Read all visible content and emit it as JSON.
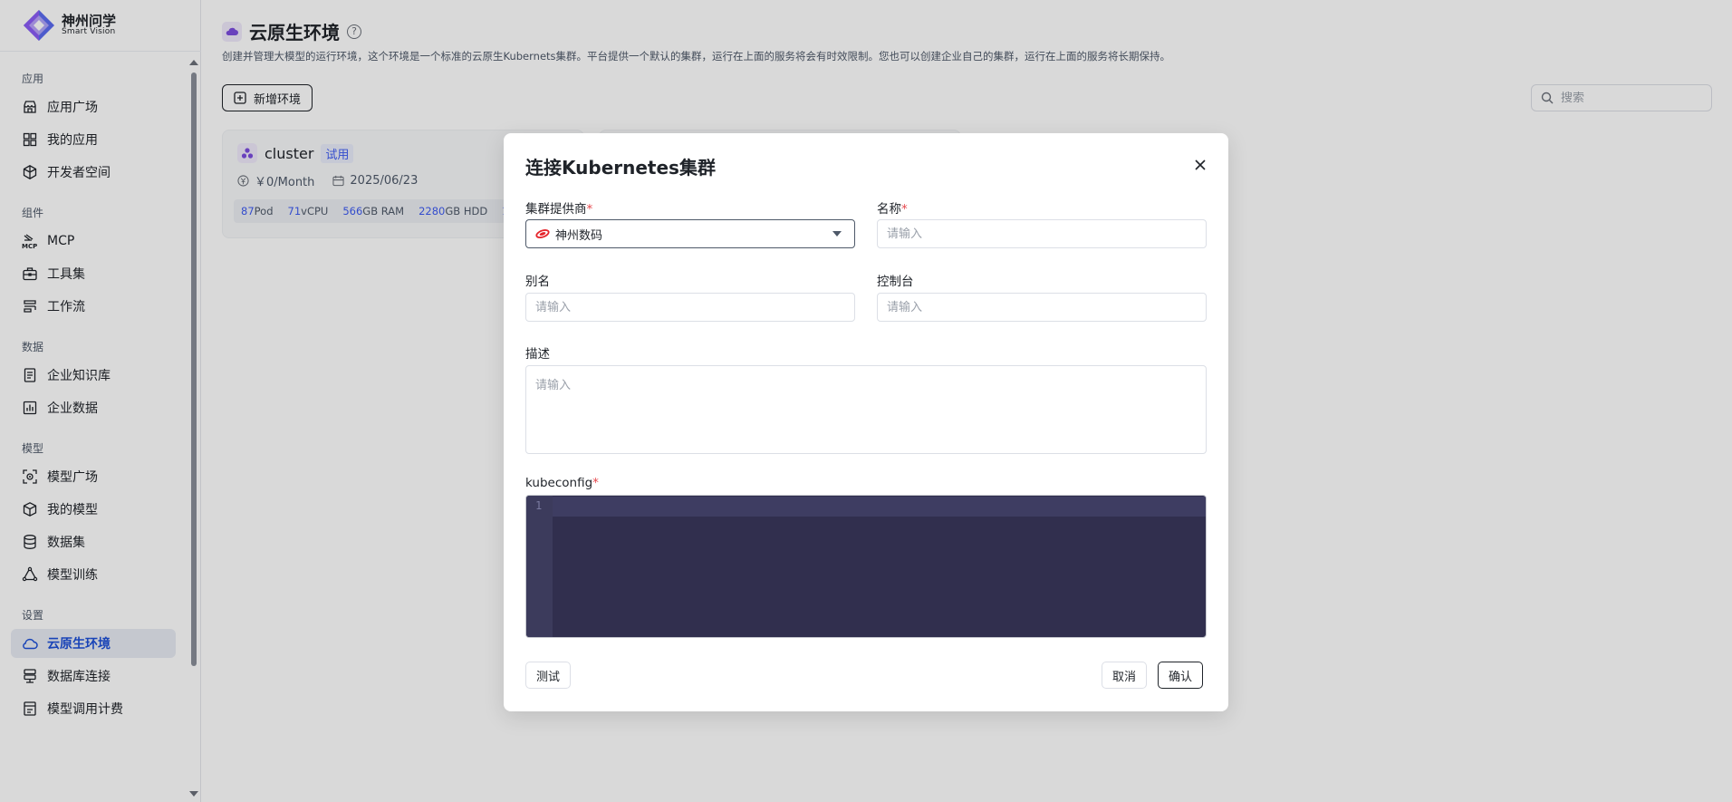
{
  "brand": {
    "name": "神州问学",
    "sub": "Smart Vision"
  },
  "sidebar": {
    "groups": [
      {
        "title": "应用",
        "items": [
          {
            "label": "应用广场",
            "icon": "store-icon"
          },
          {
            "label": "我的应用",
            "icon": "grid-icon"
          },
          {
            "label": "开发者空间",
            "icon": "hexagon-icon"
          }
        ]
      },
      {
        "title": "组件",
        "items": [
          {
            "label": "MCP",
            "icon": "mcp-icon"
          },
          {
            "label": "工具集",
            "icon": "toolbox-icon"
          },
          {
            "label": "工作流",
            "icon": "workflow-icon"
          }
        ]
      },
      {
        "title": "数据",
        "items": [
          {
            "label": "企业知识库",
            "icon": "book-icon"
          },
          {
            "label": "企业数据",
            "icon": "bar-chart-icon"
          }
        ]
      },
      {
        "title": "模型",
        "items": [
          {
            "label": "模型广场",
            "icon": "scan-icon"
          },
          {
            "label": "我的模型",
            "icon": "cube-icon"
          },
          {
            "label": "数据集",
            "icon": "database-icon"
          },
          {
            "label": "模型训练",
            "icon": "triangle-icon"
          }
        ]
      },
      {
        "title": "设置",
        "items": [
          {
            "label": "云原生环境",
            "icon": "cloud-icon",
            "active": true
          },
          {
            "label": "数据库连接",
            "icon": "db-link-icon"
          },
          {
            "label": "模型调用计费",
            "icon": "billing-icon"
          }
        ]
      }
    ]
  },
  "page": {
    "title": "云原生环境",
    "help": "?",
    "description": "创建并管理大模型的运行环境，这个环境是一个标准的云原生Kubernets集群。平台提供一个默认的集群，运行在上面的服务将会有时效限制。您也可以创建企业自己的集群，运行在上面的服务将长期保持。",
    "add_button": "新增环境",
    "search_placeholder": "搜索"
  },
  "cards": [
    {
      "name": "cluster",
      "tag": "试用",
      "price": "￥0/Month",
      "date": "2025/06/23",
      "stats": [
        {
          "value": "87",
          "unit": "Pod"
        },
        {
          "value": "71",
          "unit": "vCPU"
        },
        {
          "value": "566",
          "unit": "GB RAM"
        },
        {
          "value": "2280",
          "unit": "GB HDD"
        },
        {
          "value": "1",
          "unit": ""
        }
      ]
    }
  ],
  "modal": {
    "title": "连接Kubernetes集群",
    "provider_label": "集群提供商",
    "provider_value": "神州数码",
    "name_label": "名称",
    "alias_label": "别名",
    "console_label": "控制台",
    "desc_label": "描述",
    "kubeconfig_label": "kubeconfig",
    "placeholder": "请输入",
    "line_number": "1",
    "required_mark": "*",
    "test_button": "测试",
    "cancel_button": "取消",
    "confirm_button": "确认"
  },
  "colors": {
    "accent": "#1d4fd8",
    "required": "#e5484d",
    "editor_bg": "#312f4e"
  }
}
